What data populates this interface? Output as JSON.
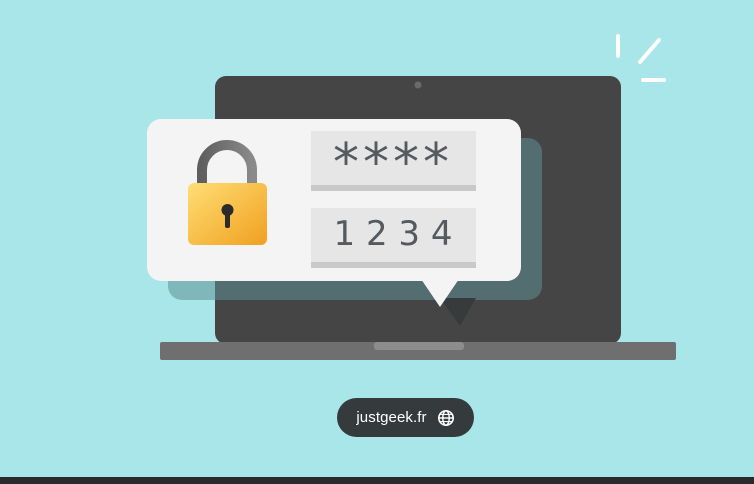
{
  "illustration": {
    "masked_code": "****",
    "revealed_code": "1 2 3 4",
    "colors": {
      "background": "#a8e6ea",
      "laptop": "#454545",
      "laptop_base": "#6f6f6f",
      "bubble": "#f4f4f4",
      "field": "#e6e6e6",
      "field_underline": "#c9c9c9",
      "lock_body_top": "#ffd86b",
      "lock_body_bottom": "#f2a324",
      "shackle": "#666666"
    },
    "icons": [
      "padlock-icon",
      "laptop-icon",
      "spark-lines-icon"
    ]
  },
  "source_badge": {
    "label": "justgeek.fr",
    "icon": "globe-icon"
  }
}
